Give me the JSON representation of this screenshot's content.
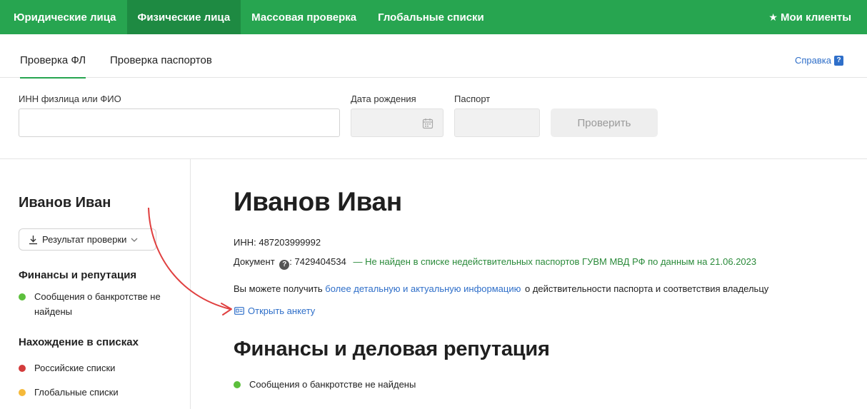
{
  "topnav": {
    "items": [
      {
        "label": "Юридические лица",
        "active": false
      },
      {
        "label": "Физические лица",
        "active": true
      },
      {
        "label": "Массовая проверка",
        "active": false
      },
      {
        "label": "Глобальные списки",
        "active": false
      }
    ],
    "my_clients": "Мои клиенты"
  },
  "subtabs": {
    "items": [
      {
        "label": "Проверка ФЛ",
        "active": true
      },
      {
        "label": "Проверка паспортов",
        "active": false
      }
    ],
    "help": "Справка"
  },
  "form": {
    "inn_label": "ИНН физлица или ФИО",
    "inn_value": "",
    "birth_label": "Дата рождения",
    "passport_label": "Паспорт",
    "check_button": "Проверить"
  },
  "sidebar": {
    "name": "Иванов Иван",
    "result_button": "Результат проверки",
    "sections": [
      {
        "title": "Финансы и репутация",
        "items": [
          {
            "text_1": "Сообщения о банкротстве не",
            "text_2": "найдены",
            "status": "#5cbf3c"
          }
        ]
      },
      {
        "title": "Нахождение в списках",
        "items": [
          {
            "text": "Российские списки",
            "status": "#d33b3b"
          },
          {
            "text": "Глобальные списки",
            "status": "#f5b93a"
          }
        ]
      }
    ]
  },
  "main": {
    "title": "Иванов Иван",
    "inn": "ИНН: 487203999992",
    "doc_label": "Документ",
    "doc_number": ": 7429404534",
    "doc_status": "— Не найден в списке недействительных паспортов ГУВМ МВД РФ по данным на 21.06.2023",
    "info_prefix": "Вы можете получить",
    "info_link": "более детальную и актуальную информацию",
    "info_suffix": "о действительности паспорта и соответствия владельцу",
    "open_form": "Открыть анкету",
    "finance_title": "Финансы и деловая репутация",
    "finance_item": "Сообщения о банкротстве не найдены",
    "finance_status": "#5cbf3c"
  },
  "icons": {
    "star": "star-icon",
    "help": "question-icon",
    "calendar": "calendar-icon",
    "download": "download-icon",
    "chevron": "chevron-down-icon",
    "card": "id-card-icon",
    "arrow": "red-arrow-annotation"
  },
  "colors": {
    "brand": "#27a550",
    "link": "#2f6fc9",
    "annotation": "#e04040"
  }
}
